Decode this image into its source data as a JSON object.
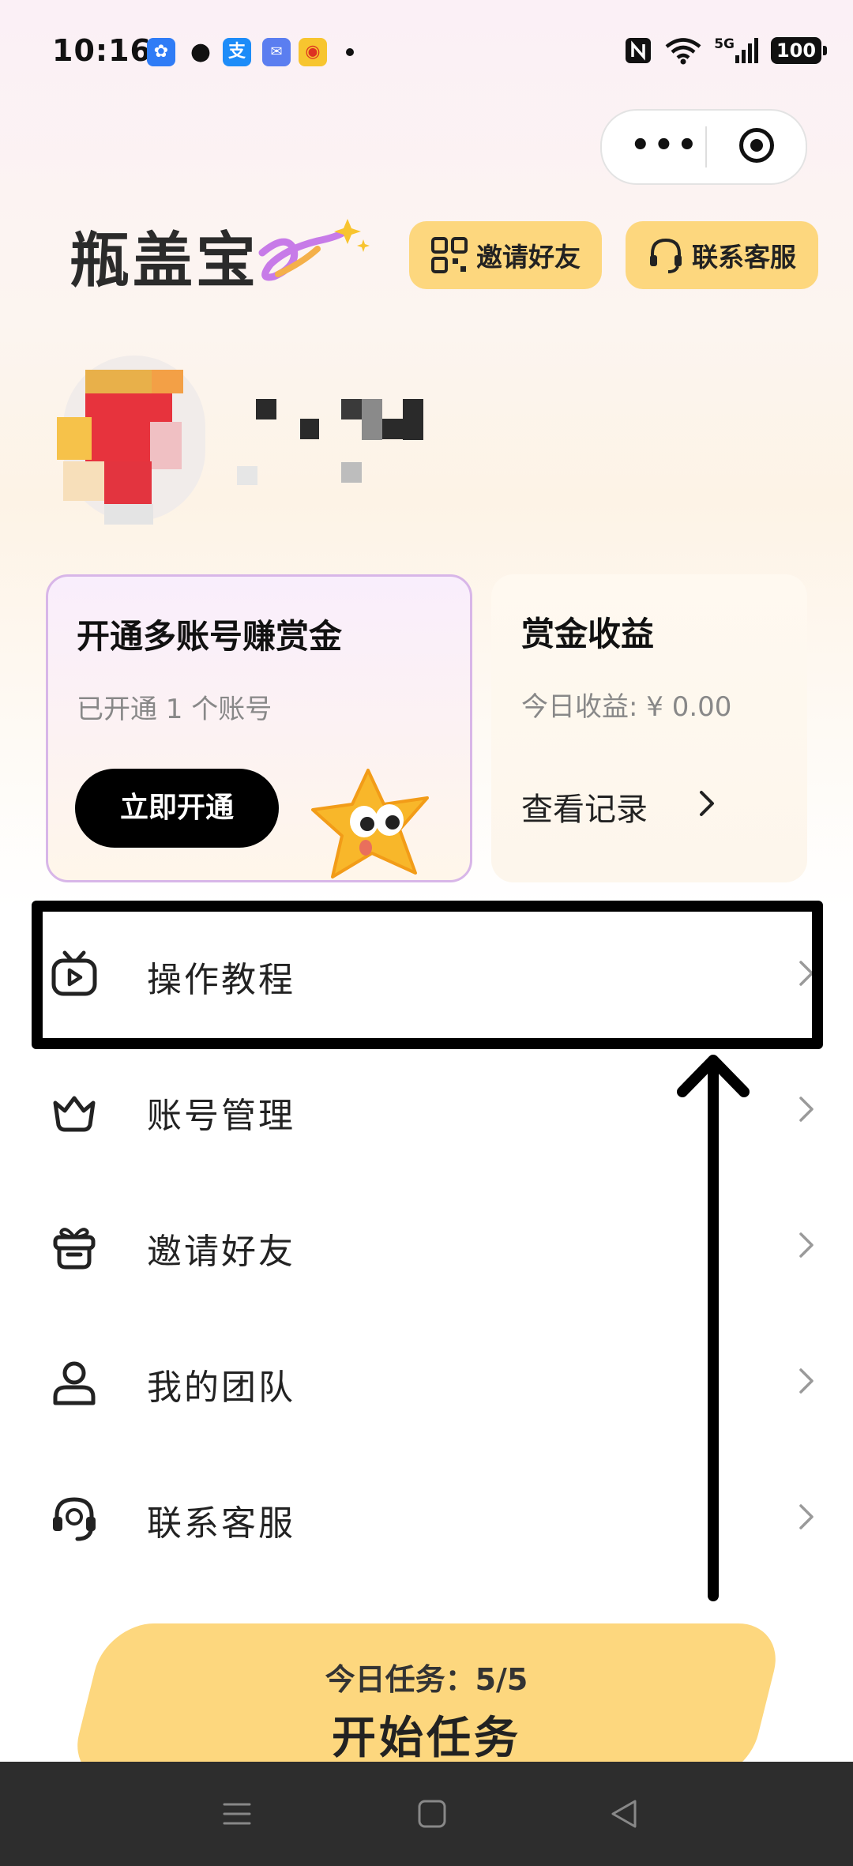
{
  "status_bar": {
    "time": "10:16",
    "network": "5G",
    "battery": "100"
  },
  "header": {
    "logo_text": "瓶盖宝",
    "invite_label": "邀请好友",
    "service_label": "联系客服"
  },
  "cards": {
    "accounts_title": "开通多账号赚赏金",
    "accounts_sub": "已开通 1 个账号",
    "open_label": "立即开通",
    "earnings_title": "赏金收益",
    "earnings_today": "今日收益: ¥ 0.00",
    "records_label": "查看记录"
  },
  "menu": [
    {
      "label": "操作教程",
      "icon": "tv-play-icon"
    },
    {
      "label": "账号管理",
      "icon": "crown-icon"
    },
    {
      "label": "邀请好友",
      "icon": "gift-icon"
    },
    {
      "label": "我的团队",
      "icon": "user-icon"
    },
    {
      "label": "联系客服",
      "icon": "headset-icon"
    }
  ],
  "task_bar": {
    "today_tasks": "今日任务：5/5",
    "start_label": "开始任务"
  },
  "colors": {
    "accent_yellow": "#fdd77e",
    "highlight_border": "#000000",
    "nav_bar": "#2d2d2d"
  }
}
